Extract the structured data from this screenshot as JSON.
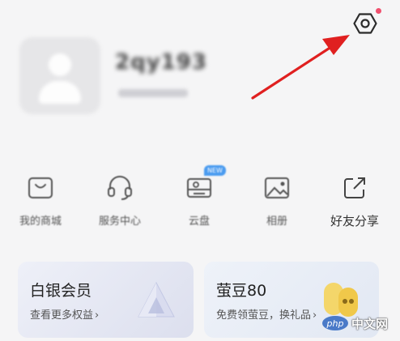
{
  "profile": {
    "username": "2qy193"
  },
  "settings": {
    "has_notification": true
  },
  "tools": [
    {
      "label": "我的商城",
      "icon": "mall-icon"
    },
    {
      "label": "服务中心",
      "icon": "headset-icon"
    },
    {
      "label": "云盘",
      "icon": "cloud-drive-icon",
      "badge": "NEW"
    },
    {
      "label": "相册",
      "icon": "gallery-icon"
    },
    {
      "label": "好友分享",
      "icon": "share-icon"
    }
  ],
  "cards": {
    "vip": {
      "title": "白银会员",
      "subtitle": "查看更多权益",
      "chevron": "›"
    },
    "coin": {
      "title": "萤豆80",
      "subtitle": "免费领萤豆，换礼品",
      "chevron": "›"
    }
  },
  "watermark": {
    "logo": "php",
    "text": "中文网"
  },
  "colors": {
    "accent": "#4a9bf0",
    "notification": "#f0506e",
    "annotation_arrow": "#e02020"
  }
}
